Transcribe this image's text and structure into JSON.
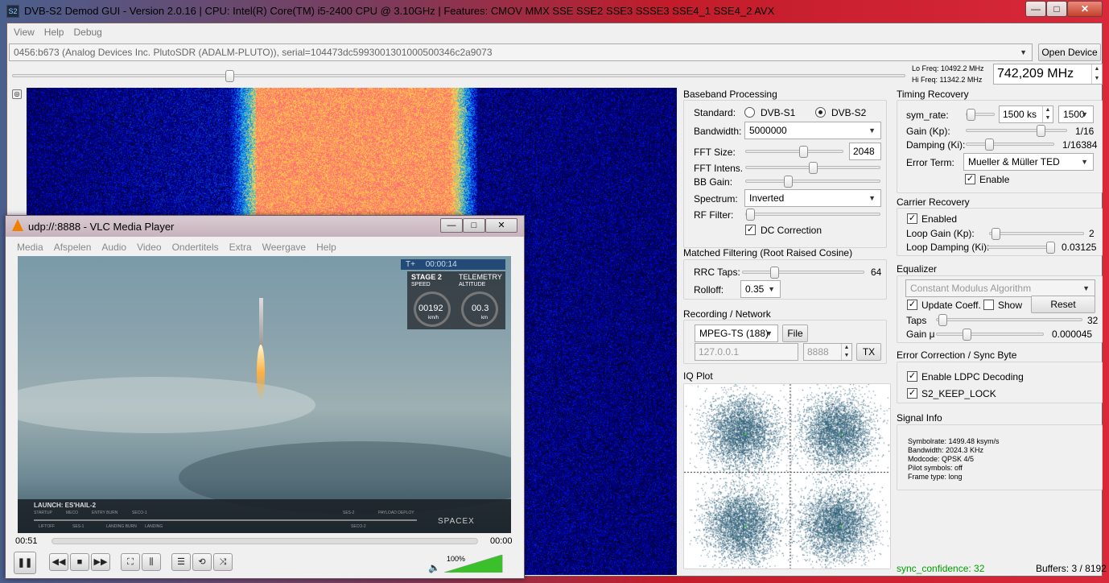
{
  "window": {
    "title": "DVB-S2 Demod GUI - Version 2.0.16 | CPU:       Intel(R) Core(TM) i5-2400 CPU @ 3.10GHz | Features: CMOV MMX SSE SSE2 SSE3 SSSE3 SSE4_1 SSE4_2 AVX",
    "minimize": "—",
    "maximize": "□",
    "close": "✕"
  },
  "menu": [
    "View",
    "Help",
    "Debug"
  ],
  "device": {
    "value": "0456:b673 (Analog Devices Inc. PlutoSDR (ADALM-PLUTO)), serial=104473dc5993001301000500346c2a9073",
    "open_label": "Open Device"
  },
  "freq": {
    "lo": "Lo Freq: 10492.2 MHz",
    "hi": "Hi Freq: 11342.2 MHz",
    "value": "742,209 MHz",
    "slider_pos": 0.24
  },
  "baseband": {
    "title": "Baseband Processing",
    "standard_label": "Standard:",
    "dvbs1": "DVB-S1",
    "dvbs2": "DVB-S2",
    "bandwidth_label": "Bandwidth:",
    "bandwidth_value": "5000000",
    "fft_size_label": "FFT Size:",
    "fft_size_value": "2048",
    "fft_intens_label": "FFT Intens.",
    "bb_gain_label": "BB Gain:",
    "spectrum_label": "Spectrum:",
    "spectrum_value": "Inverted",
    "rf_filter_label": "RF Filter:",
    "dc_correction": "DC Correction"
  },
  "matched": {
    "title": "Matched Filtering (Root Raised Cosine)",
    "rrc_label": "RRC Taps:",
    "rrc_value": "64",
    "rolloff_label": "Rolloff:",
    "rolloff_value": "0.35"
  },
  "recording": {
    "title": "Recording / Network",
    "format": "MPEG-TS (188)",
    "file_label": "File",
    "ip": "127.0.0.1",
    "port": "8888",
    "tx_label": "TX"
  },
  "iq": {
    "title": "IQ Plot"
  },
  "timing": {
    "title": "Timing Recovery",
    "symrate_label": "sym_rate:",
    "symrate_value": "1500 ks",
    "symrate_select": "1500",
    "gain_label": "Gain (Kp):",
    "gain_value": "1/16",
    "damping_label": "Damping (Ki):",
    "damping_value": "1/16384",
    "error_label": "Error Term:",
    "error_value": "Mueller & Müller TED",
    "enable_label": "Enable"
  },
  "carrier": {
    "title": "Carrier Recovery",
    "enabled_label": "Enabled",
    "loop_gain_label": "Loop Gain (Kp):",
    "loop_gain_value": "2",
    "loop_damp_label": "Loop Damping (Ki):",
    "loop_damp_value": "0.03125"
  },
  "equalizer": {
    "title": "Equalizer",
    "algorithm": "Constant Modulus Algorithm",
    "update_label": "Update Coeff.",
    "show_label": "Show",
    "reset_label": "Reset",
    "taps_label": "Taps",
    "taps_value": "32",
    "gain_label": "Gain μ",
    "gain_value": "0.000045"
  },
  "ecc": {
    "title": "Error Correction / Sync Byte",
    "ldpc_label": "Enable LDPC Decoding",
    "keep_lock_label": "S2_KEEP_LOCK"
  },
  "signal": {
    "title": "Signal Info",
    "symbolrate": "Symbolrate: 1499.48 ksym/s",
    "bandwidth": "Bandwidth: 2024.3 KHz",
    "modcode": "Modcode: QPSK 4/5",
    "pilot": "Pilot symbols: off",
    "frame": "Frame type: long"
  },
  "status": {
    "sync": "sync_confidence: 32",
    "buffers": "Buffers: 3 / 8192"
  },
  "vlc": {
    "title": "udp://:8888 - VLC Media Player",
    "menu": [
      "Media",
      "Afspelen",
      "Audio",
      "Video",
      "Ondertitels",
      "Extra",
      "Weergave",
      "Help"
    ],
    "time_elapsed": "00:51",
    "time_total": "00:00",
    "volume": "100%",
    "volume_level": 1.0,
    "overlay": {
      "timer_prefix": "T+",
      "timer": "00:00:14",
      "stage": "STAGE 2",
      "telemetry": "TELEMETRY",
      "speed_label": "SPEED",
      "altitude_label": "ALTITUDE",
      "speed": "00192",
      "speed_unit": "km/h",
      "altitude": "00.3",
      "altitude_unit": "km",
      "launch": "LAUNCH: ES'HAIL-2",
      "brand": "SPACEX",
      "events": [
        "STARTUP",
        "LIFTOFF",
        "MECO",
        "SES-1",
        "ENTRY BURN",
        "LANDING BURN",
        "SECO-1",
        "LANDING",
        "SES-2",
        "SECO-2",
        "PAYLOAD DEPLOY"
      ]
    }
  },
  "colors": {
    "accent": "#3a6ea5",
    "iq_points": "#2e5f78",
    "sync_text": "#00a000",
    "vlc_orange": "#f08000"
  }
}
